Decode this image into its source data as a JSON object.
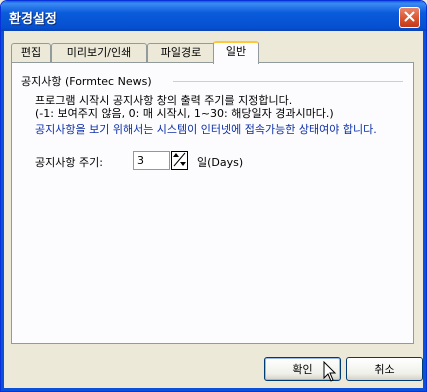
{
  "window": {
    "title": "환경설정"
  },
  "tabs": [
    {
      "label": "편집"
    },
    {
      "label": "미리보기/인쇄"
    },
    {
      "label": "파일경로"
    },
    {
      "label": "일반"
    }
  ],
  "group": {
    "title": "공지사항 (Formtec News)",
    "desc1": "프로그램 시작시 공지사항 창의 출력 주기를 지정합니다.",
    "desc2": "(-1: 보여주지 않음, 0: 매 시작시, 1~30: 해당일자 경과시마다.)",
    "notice": "공지사항을 보기 위해서는 시스템이 인터넷에 접속가능한 상태여야 합니다.",
    "period_label": "공지사항 주기:",
    "period_value": "3",
    "unit": "일(Days)"
  },
  "buttons": {
    "ok": "확인",
    "cancel": "취소"
  },
  "icons": {
    "close": "close-icon",
    "spinner": "spinner-arrows-icon",
    "cursor": "mouse-pointer-icon"
  }
}
